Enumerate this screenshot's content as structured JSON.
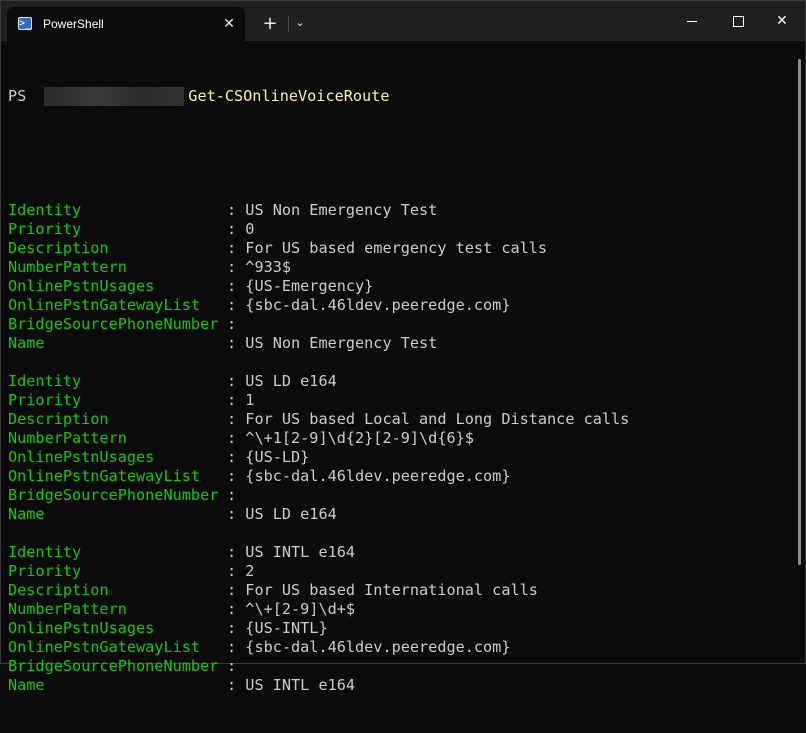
{
  "window": {
    "tab_title": "PowerShell",
    "tab_icon": "powershell-icon",
    "tab_icon_glyph": ">_",
    "tab_close_glyph": "✕",
    "new_tab_glyph": "+",
    "dropdown_glyph": "⌄",
    "close_glyph": "✕"
  },
  "prompt": {
    "ps": "PS",
    "command": "Get-CSOnlineVoiceRoute"
  },
  "colors": {
    "key": "#16c60c",
    "command": "#f9f1a5",
    "text": "#cccccc",
    "background": "#0c0c0c"
  },
  "routes": [
    {
      "fields": [
        {
          "key": "Identity",
          "value": "US Non Emergency Test"
        },
        {
          "key": "Priority",
          "value": "0"
        },
        {
          "key": "Description",
          "value": "For US based emergency test calls"
        },
        {
          "key": "NumberPattern",
          "value": "^933$"
        },
        {
          "key": "OnlinePstnUsages",
          "value": "{US-Emergency}"
        },
        {
          "key": "OnlinePstnGatewayList",
          "value": "{sbc-dal.46ldev.peeredge.com}"
        },
        {
          "key": "BridgeSourcePhoneNumber",
          "value": ""
        },
        {
          "key": "Name",
          "value": "US Non Emergency Test"
        }
      ]
    },
    {
      "fields": [
        {
          "key": "Identity",
          "value": "US LD e164"
        },
        {
          "key": "Priority",
          "value": "1"
        },
        {
          "key": "Description",
          "value": "For US based Local and Long Distance calls"
        },
        {
          "key": "NumberPattern",
          "value": "^\\+1[2-9]\\d{2}[2-9]\\d{6}$"
        },
        {
          "key": "OnlinePstnUsages",
          "value": "{US-LD}"
        },
        {
          "key": "OnlinePstnGatewayList",
          "value": "{sbc-dal.46ldev.peeredge.com}"
        },
        {
          "key": "BridgeSourcePhoneNumber",
          "value": ""
        },
        {
          "key": "Name",
          "value": "US LD e164"
        }
      ]
    },
    {
      "fields": [
        {
          "key": "Identity",
          "value": "US INTL e164"
        },
        {
          "key": "Priority",
          "value": "2"
        },
        {
          "key": "Description",
          "value": "For US based International calls"
        },
        {
          "key": "NumberPattern",
          "value": "^\\+[2-9]\\d+$"
        },
        {
          "key": "OnlinePstnUsages",
          "value": "{US-INTL}"
        },
        {
          "key": "OnlinePstnGatewayList",
          "value": "{sbc-dal.46ldev.peeredge.com}"
        },
        {
          "key": "BridgeSourcePhoneNumber",
          "value": ""
        },
        {
          "key": "Name",
          "value": "US INTL e164"
        }
      ]
    }
  ]
}
